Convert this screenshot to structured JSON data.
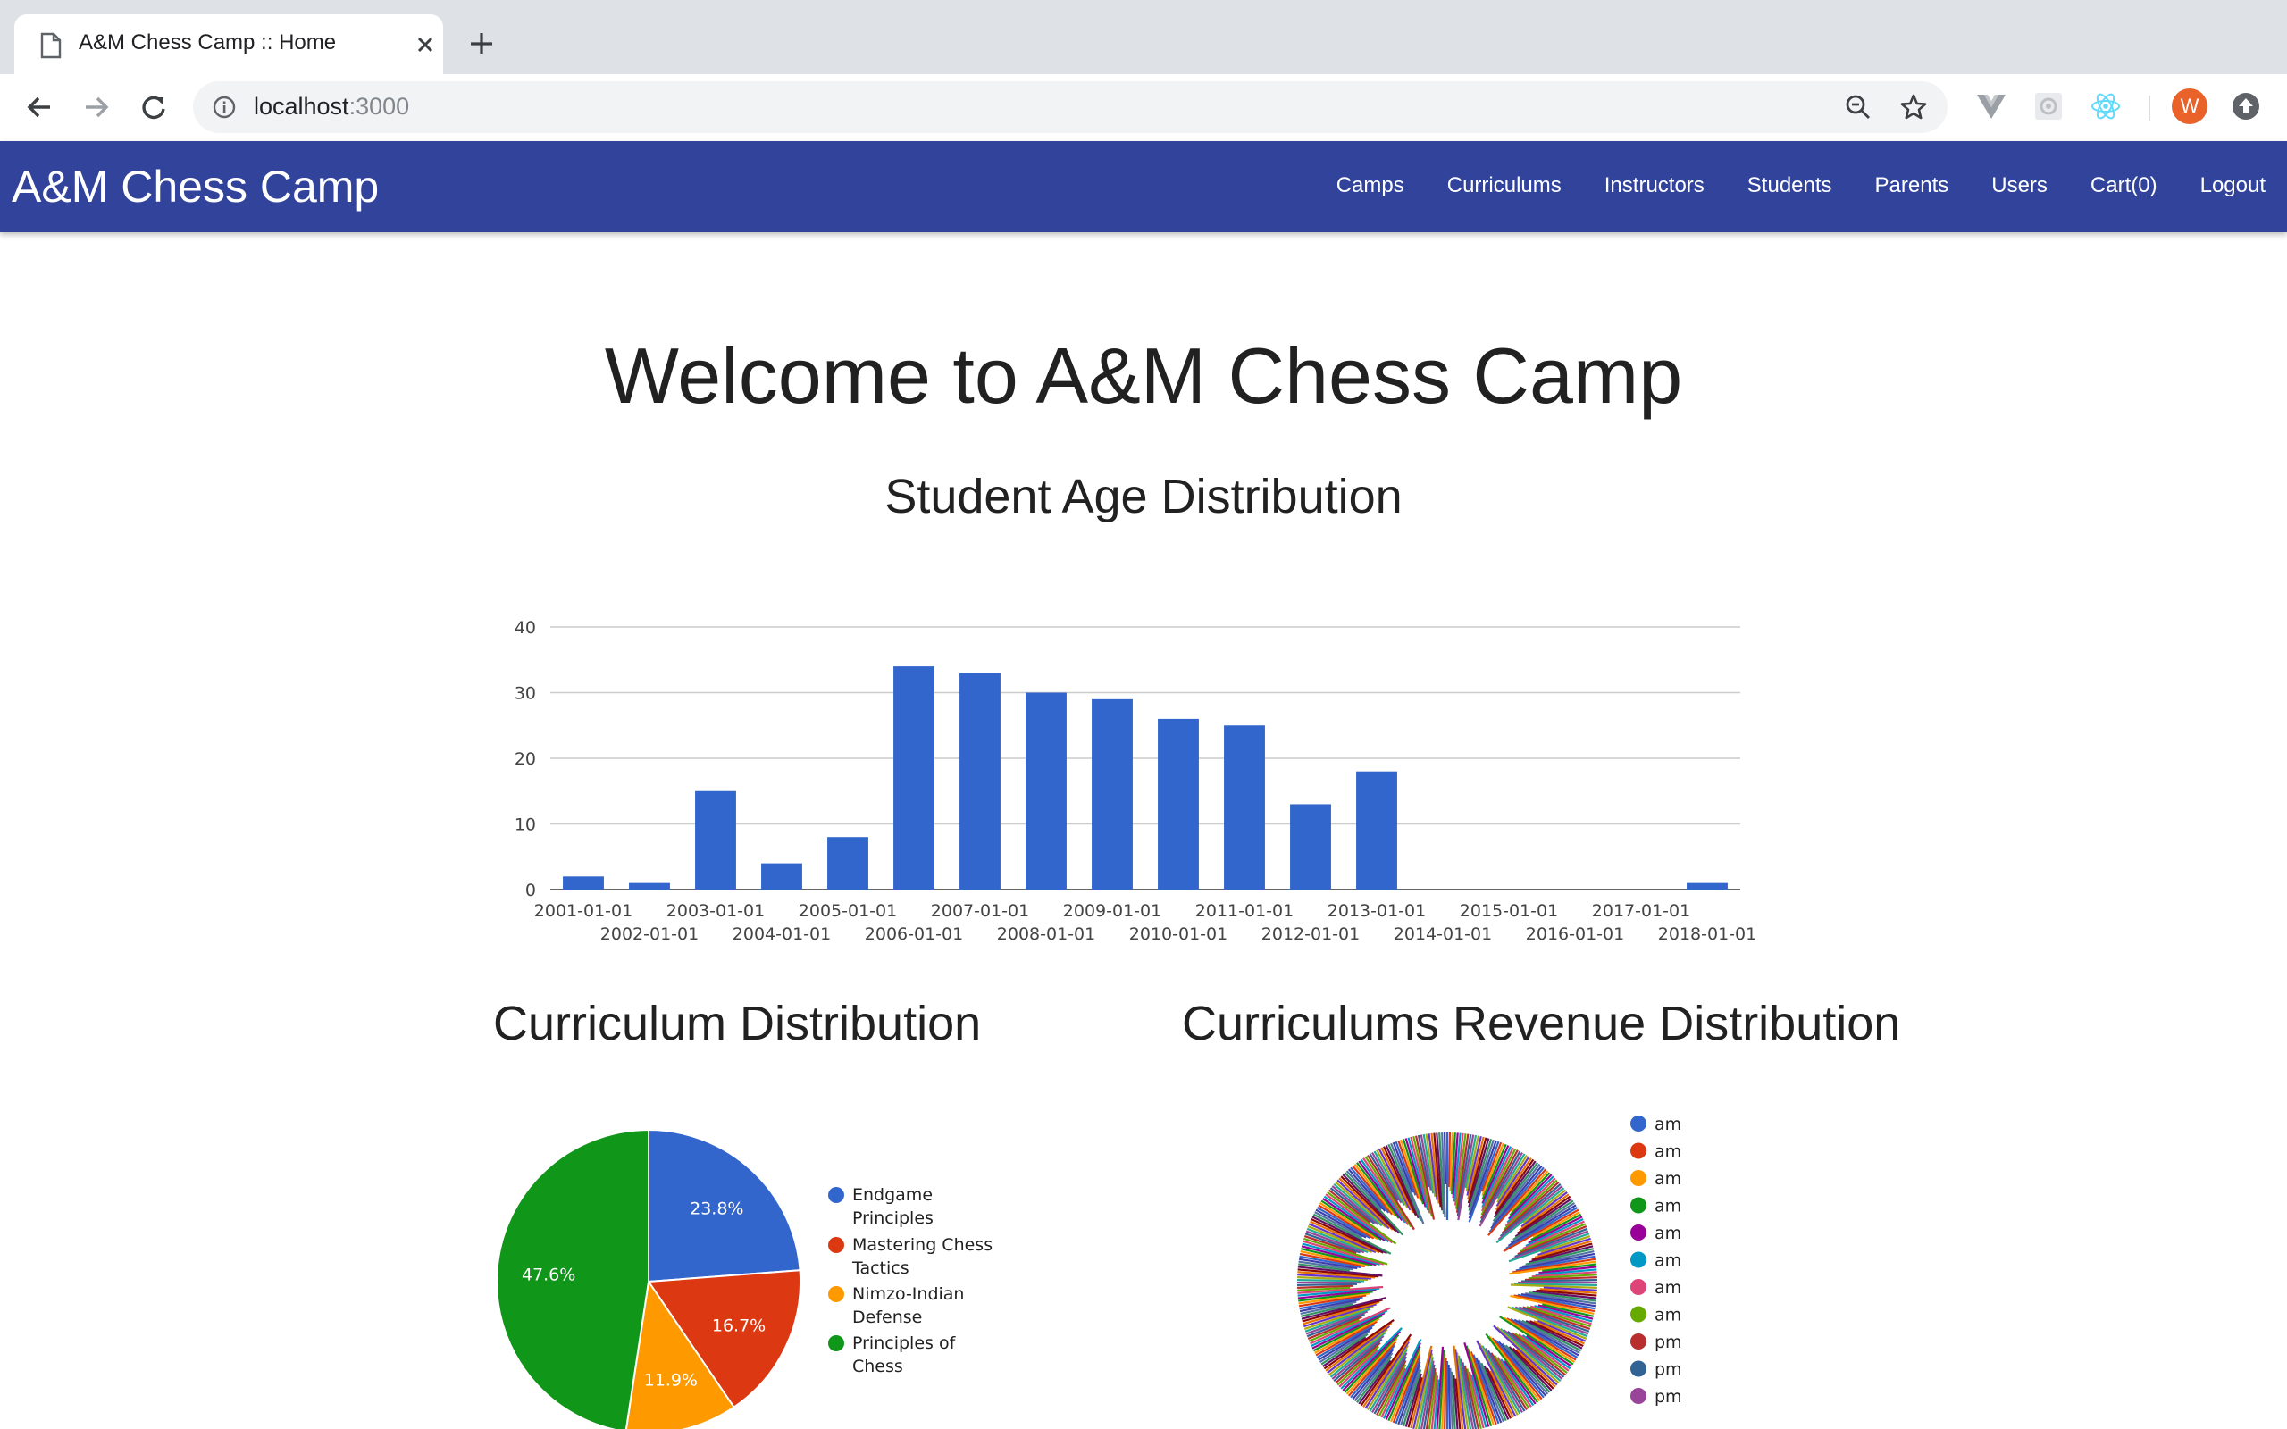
{
  "browser": {
    "tab_title": "A&M Chess Camp :: Home",
    "url_host": "localhost",
    "url_port": ":3000",
    "profile_initial": "W"
  },
  "navbar": {
    "brand": "A&M Chess Camp",
    "links": [
      "Camps",
      "Curriculums",
      "Instructors",
      "Students",
      "Parents",
      "Users",
      "Cart(0)",
      "Logout"
    ]
  },
  "main": {
    "heading": "Welcome to A&M Chess Camp",
    "age_title": "Student Age Distribution",
    "curriculum_title": "Curriculum Distribution",
    "revenue_title": "Curriculums Revenue Distribution"
  },
  "chart_data": [
    {
      "type": "bar",
      "title": "Student Age Distribution",
      "categories": [
        "2001-01-01",
        "2002-01-01",
        "2003-01-01",
        "2004-01-01",
        "2005-01-01",
        "2006-01-01",
        "2007-01-01",
        "2008-01-01",
        "2009-01-01",
        "2010-01-01",
        "2011-01-01",
        "2012-01-01",
        "2013-01-01",
        "2014-01-01",
        "2015-01-01",
        "2016-01-01",
        "2017-01-01",
        "2018-01-01"
      ],
      "values": [
        2,
        1,
        15,
        4,
        8,
        34,
        33,
        30,
        29,
        26,
        25,
        13,
        18,
        0,
        0,
        0,
        0,
        1
      ],
      "y_ticks": [
        0,
        10,
        20,
        30,
        40
      ],
      "ylim": [
        0,
        40
      ],
      "grid": true,
      "color": "#3366cc"
    },
    {
      "type": "pie",
      "title": "Curriculum Distribution",
      "slices": [
        {
          "label": "Endgame Principles",
          "value": 23.8,
          "text": "23.8%",
          "color": "#3366cc"
        },
        {
          "label": "Mastering Chess Tactics",
          "value": 16.7,
          "text": "16.7%",
          "color": "#dc3912"
        },
        {
          "label": "Nimzo-Indian Defense",
          "value": 11.9,
          "text": "11.9%",
          "color": "#ff9900"
        },
        {
          "label": "Principles of Chess",
          "value": 47.6,
          "text": "47.6%",
          "color": "#109618"
        }
      ],
      "legend_lines": [
        [
          "Endgame",
          "Principles"
        ],
        [
          "Mastering Chess",
          "Tactics"
        ],
        [
          "Nimzo-Indian",
          "Defense"
        ],
        [
          "Principles of",
          "Chess"
        ]
      ],
      "legend_position": "right"
    },
    {
      "type": "pie",
      "title": "Curriculums Revenue Distribution",
      "legend": [
        {
          "label": "am",
          "color": "#3366cc"
        },
        {
          "label": "am",
          "color": "#dc3912"
        },
        {
          "label": "am",
          "color": "#ff9900"
        },
        {
          "label": "am",
          "color": "#109618"
        },
        {
          "label": "am",
          "color": "#990099"
        },
        {
          "label": "am",
          "color": "#0099c6"
        },
        {
          "label": "am",
          "color": "#dd4477"
        },
        {
          "label": "am",
          "color": "#66aa00"
        },
        {
          "label": "pm",
          "color": "#b82e2e"
        },
        {
          "label": "pm",
          "color": "#316395"
        },
        {
          "label": "pm",
          "color": "#994499"
        }
      ],
      "legend_position": "right"
    }
  ]
}
